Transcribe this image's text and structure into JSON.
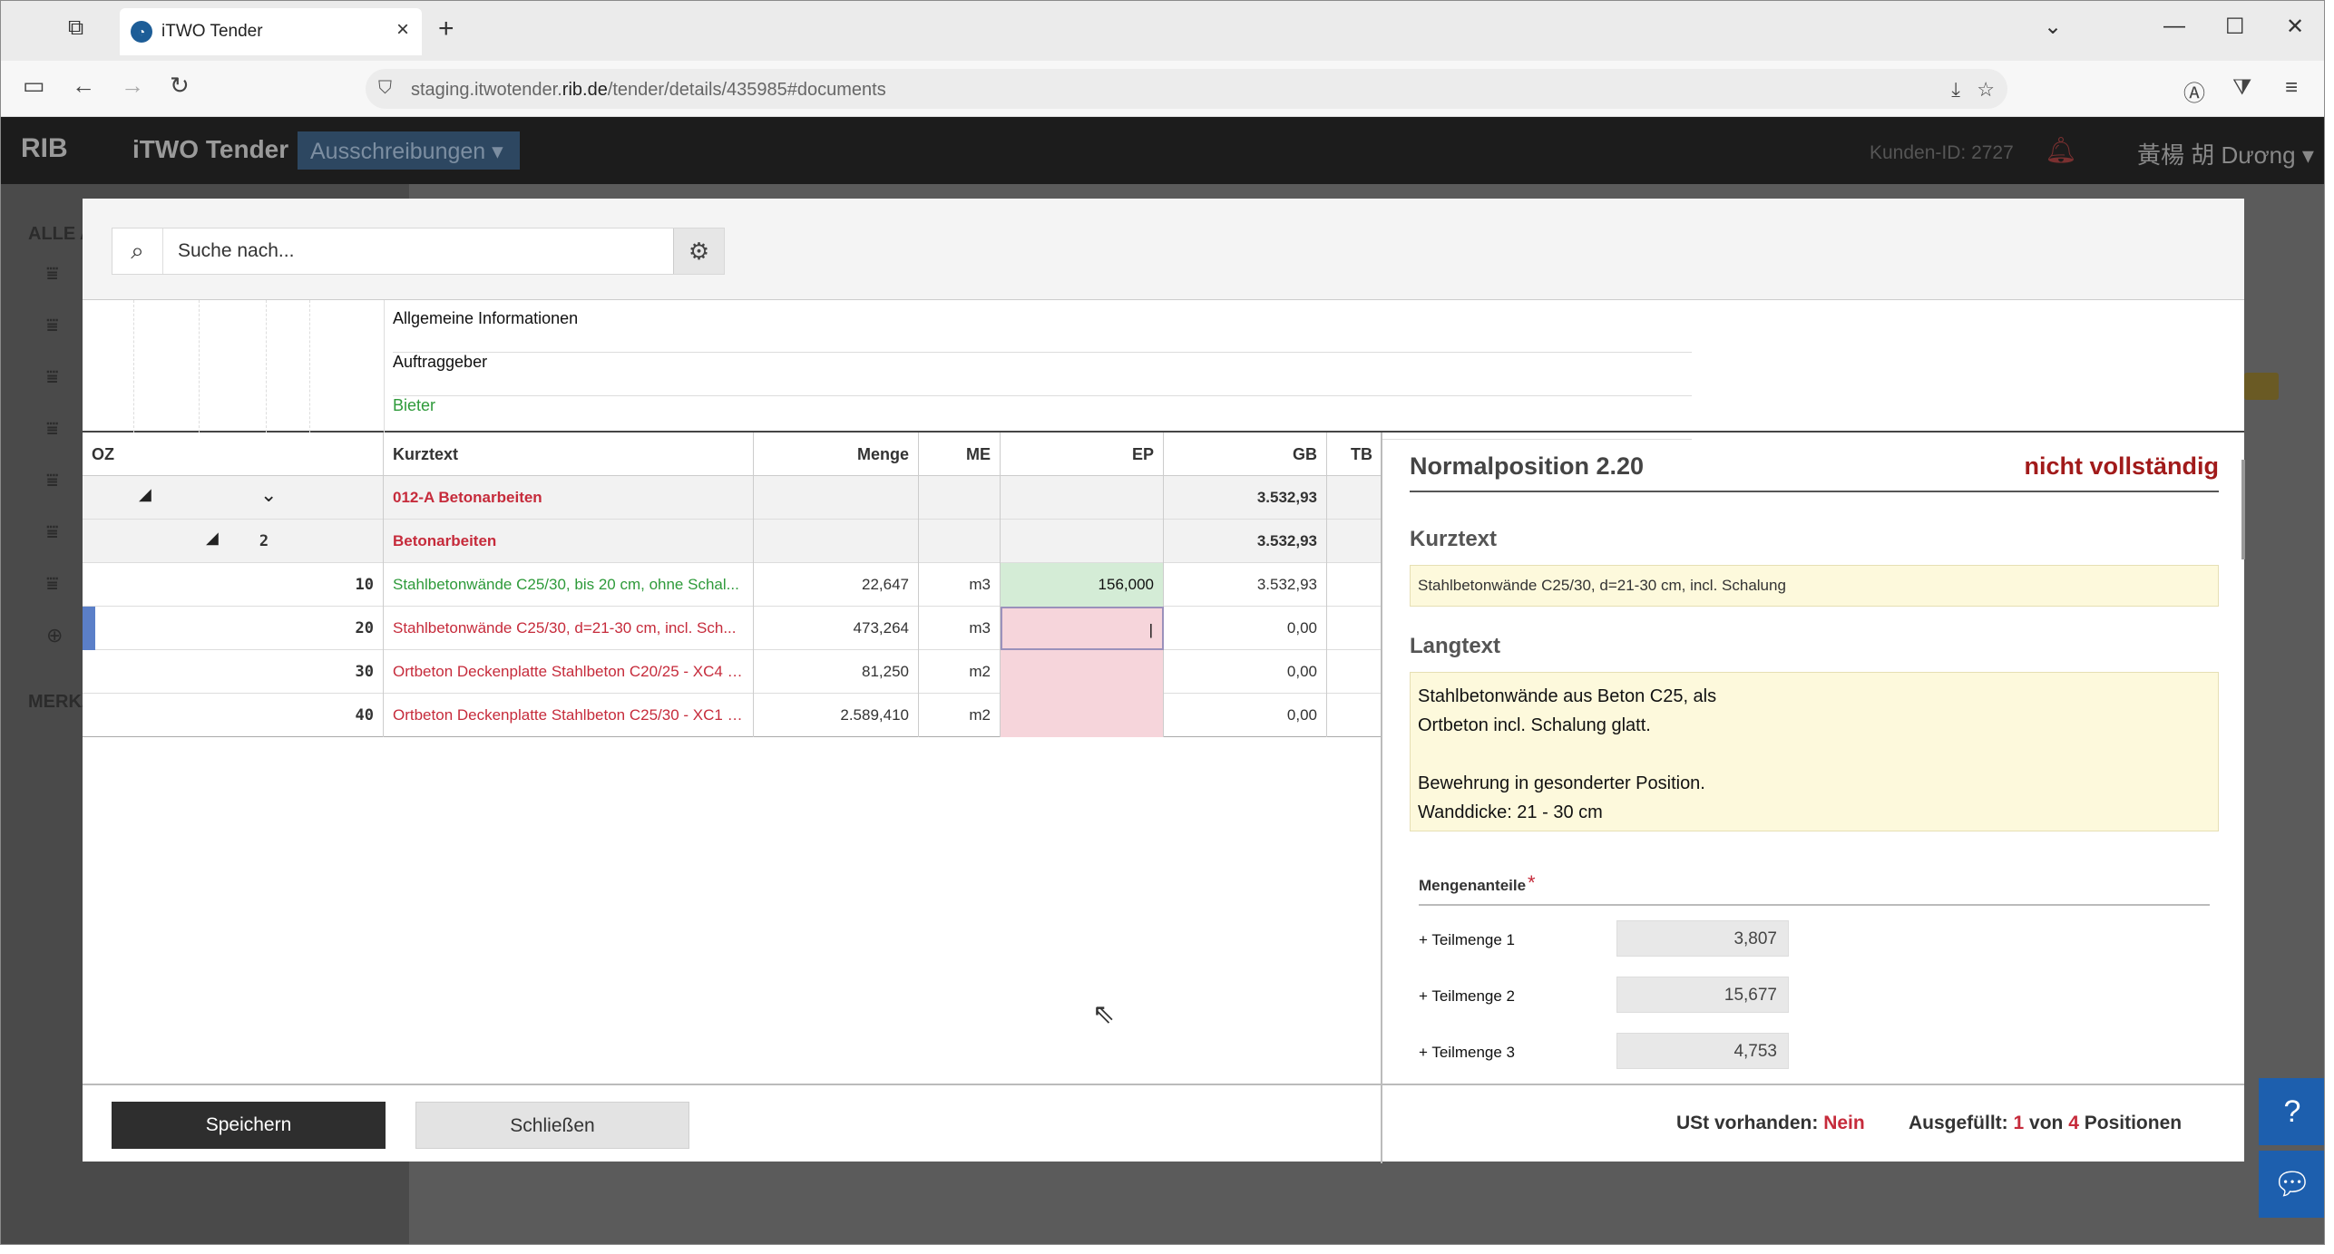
{
  "browser": {
    "tab_title": "iTWO Tender",
    "tab_favicon": "rib-logo-icon",
    "url_prefix": "staging.itwotender.",
    "url_domain": "rib.de",
    "url_path": "/tender/details/435985#documents"
  },
  "app": {
    "logo": "RIB",
    "name": "iTWO Tender",
    "menu": "Ausschreibungen",
    "kunden_id": "Kunden-ID: 2727",
    "user": "黃楊 胡 Dương"
  },
  "background": {
    "side_title_1": "ALLE A",
    "side_title_2": "MERKZ"
  },
  "search": {
    "placeholder": "Suche nach..."
  },
  "info_rows": [
    "Allgemeine Informationen",
    "Auftraggeber",
    "Bieter"
  ],
  "table": {
    "headers": {
      "oz": "OZ",
      "kurztext": "Kurztext",
      "menge": "Menge",
      "me": "ME",
      "ep": "EP",
      "gb": "GB",
      "tb": "TB"
    },
    "rows": [
      {
        "oz": "",
        "kurztext": "012-A Betonarbeiten",
        "menge": "",
        "me": "",
        "ep": "",
        "gb": "3.532,93"
      },
      {
        "oz": "2",
        "kurztext": "Betonarbeiten",
        "menge": "",
        "me": "",
        "ep": "",
        "gb": "3.532,93"
      },
      {
        "oz": "10",
        "kurztext": "Stahlbetonwände C25/30, bis 20 cm, ohne Schal...",
        "menge": "22,647",
        "me": "m3",
        "ep": "156,000",
        "gb": "3.532,93"
      },
      {
        "oz": "20",
        "kurztext": "Stahlbetonwände C25/30, d=21-30 cm, incl. Sch...",
        "menge": "473,264",
        "me": "m3",
        "ep": "|",
        "gb": "0,00"
      },
      {
        "oz": "30",
        "kurztext": "Ortbeton Deckenplatte Stahlbeton C20/25 - XC4 -...",
        "menge": "81,250",
        "me": "m2",
        "ep": "",
        "gb": "0,00"
      },
      {
        "oz": "40",
        "kurztext": "Ortbeton Deckenplatte Stahlbeton C25/30 - XC1 -...",
        "menge": "2.589,410",
        "me": "m2",
        "ep": "",
        "gb": "0,00"
      }
    ]
  },
  "detail": {
    "title": "Normalposition 2.20",
    "state": "nicht vollständig",
    "kurztext_label": "Kurztext",
    "kurztext_value": "Stahlbetonwände C25/30, d=21-30 cm, incl. Schalung",
    "langtext_label": "Langtext",
    "langtext_lines": [
      "Stahlbetonwände aus Beton C25, als",
      "Ortbeton incl. Schalung glatt.",
      "",
      "Bewehrung in gesonderter Position.",
      "Wanddicke: 21 - 30 cm"
    ],
    "mengenanteile_label": "Mengenanteile",
    "required_mark": "*",
    "teilmengen": [
      {
        "label": "+ Teilmenge 1",
        "value": "3,807"
      },
      {
        "label": "+ Teilmenge 2",
        "value": "15,677"
      },
      {
        "label": "+ Teilmenge 3",
        "value": "4,753"
      }
    ]
  },
  "footer": {
    "save": "Speichern",
    "close": "Schließen",
    "ust_label": "USt vorhanden:",
    "ust_value": "Nein",
    "ausg_label": "Ausgefüllt:",
    "ausg_done": "1",
    "ausg_von": "von",
    "ausg_total": "4",
    "ausg_suffix": "Positionen"
  }
}
